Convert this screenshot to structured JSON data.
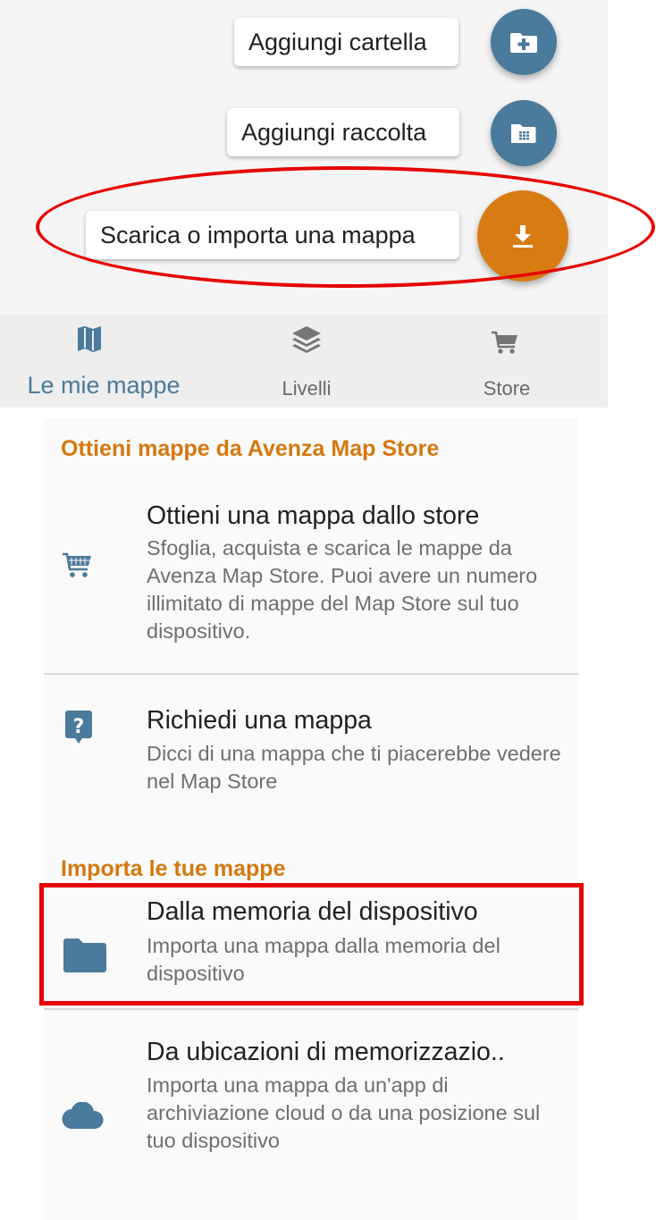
{
  "fab_menu": {
    "items": [
      {
        "label": "Aggiungi cartella",
        "icon": "add-folder-icon",
        "color": "#4a7a9c"
      },
      {
        "label": "Aggiungi raccolta",
        "icon": "collection-icon",
        "color": "#4a7a9c"
      },
      {
        "label": "Scarica o importa una mappa",
        "icon": "download-icon",
        "color": "#d97b13"
      }
    ]
  },
  "tabbar": {
    "tabs": [
      {
        "label": "Le mie mappe",
        "icon": "map-icon",
        "active": true,
        "color": "#4a7a9c"
      },
      {
        "label": "Livelli",
        "icon": "layers-icon",
        "active": false,
        "color": "#757575"
      },
      {
        "label": "Store",
        "icon": "cart-icon",
        "active": false,
        "color": "#757575"
      }
    ]
  },
  "store_section": {
    "header": "Ottieni mappe da Avenza Map Store",
    "items": [
      {
        "title": "Ottieni una mappa dallo store",
        "description": "Sfoglia, acquista e scarica le mappe da Avenza Map Store. Puoi avere un numero illimitato di mappe del Map Store sul tuo dispositivo.",
        "icon": "cart-icon"
      },
      {
        "title": "Richiedi una mappa",
        "description": "Dicci di una mappa che ti piacerebbe vedere nel Map Store",
        "icon": "question-icon"
      }
    ]
  },
  "import_section": {
    "header": "Importa le tue mappe",
    "items": [
      {
        "title": "Dalla memoria del dispositivo",
        "description": "Importa una mappa dalla memoria del dispositivo",
        "icon": "folder-icon"
      },
      {
        "title": "Da ubicazioni di memorizzazio..",
        "description": "Importa una mappa da un'app di archiviazione cloud o da una posizione sul tuo dispositivo",
        "icon": "cloud-icon"
      }
    ]
  },
  "colors": {
    "accent": "#4a7a9c",
    "orange": "#d97b13",
    "section_header": "#d4780f",
    "highlight": "#e60000"
  }
}
